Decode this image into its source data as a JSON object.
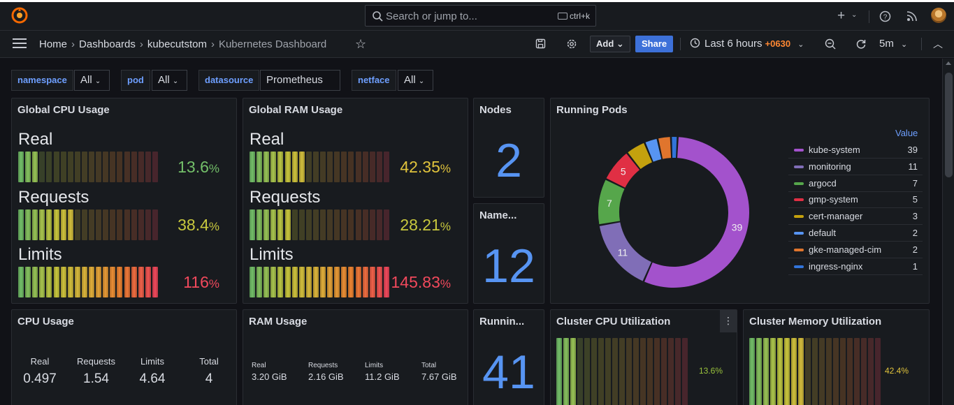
{
  "search": {
    "placeholder": "Search or jump to...",
    "shortcut": "ctrl+k"
  },
  "breadcrumb": [
    "Home",
    "Dashboards",
    "kubecutstom",
    "Kubernetes Dashboard"
  ],
  "toolbar": {
    "add_label": "Add",
    "share_label": "Share",
    "time_range": "Last 6 hours",
    "timezone": "+0630",
    "refresh_interval": "5m"
  },
  "variables": [
    {
      "label": "namespace",
      "value": "All"
    },
    {
      "label": "pod",
      "value": "All"
    },
    {
      "label": "datasource",
      "value": "Prometheus"
    },
    {
      "label": "netface",
      "value": "All"
    }
  ],
  "panels": {
    "global_cpu": {
      "title": "Global CPU Usage",
      "rows": [
        {
          "label": "Real",
          "value": "13.6",
          "unit": "%",
          "fraction": 0.136,
          "color": "#73bf69"
        },
        {
          "label": "Requests",
          "value": "38.4",
          "unit": "%",
          "fraction": 0.384,
          "color": "#c8c83e"
        },
        {
          "label": "Limits",
          "value": "116",
          "unit": "%",
          "fraction": 1.0,
          "color": "#f2495c"
        }
      ]
    },
    "global_ram": {
      "title": "Global RAM Usage",
      "rows": [
        {
          "label": "Real",
          "value": "42.35",
          "unit": "%",
          "fraction": 0.4235,
          "color": "#e0c33c"
        },
        {
          "label": "Requests",
          "value": "28.21",
          "unit": "%",
          "fraction": 0.2821,
          "color": "#c8c83e"
        },
        {
          "label": "Limits",
          "value": "145.83",
          "unit": "%",
          "fraction": 1.0,
          "color": "#f2495c"
        }
      ]
    },
    "nodes": {
      "title": "Nodes",
      "value": "2"
    },
    "namespaces": {
      "title": "Name...",
      "value": "12"
    },
    "running_pods_count": {
      "title": "Runnin...",
      "value": "41"
    },
    "running_pods": {
      "title": "Running Pods",
      "legend_header": "Value",
      "items": [
        {
          "name": "kube-system",
          "value": 39,
          "color": "#a352cc"
        },
        {
          "name": "monitoring",
          "value": 11,
          "color": "#806eb7"
        },
        {
          "name": "argocd",
          "value": 7,
          "color": "#56a64b"
        },
        {
          "name": "gmp-system",
          "value": 5,
          "color": "#e02f44"
        },
        {
          "name": "cert-manager",
          "value": 3,
          "color": "#c4a10e"
        },
        {
          "name": "default",
          "value": 2,
          "color": "#5794f2"
        },
        {
          "name": "gke-managed-cim",
          "value": 2,
          "color": "#e0752d"
        },
        {
          "name": "ingress-nginx",
          "value": 1,
          "color": "#3274d9"
        }
      ],
      "slice_labels": [
        "39",
        "11",
        "7",
        "5"
      ]
    },
    "cpu_usage": {
      "title": "CPU Usage",
      "stats": [
        {
          "label": "Real",
          "value": "0.497"
        },
        {
          "label": "Requests",
          "value": "1.54"
        },
        {
          "label": "Limits",
          "value": "4.64"
        },
        {
          "label": "Total",
          "value": "4"
        }
      ]
    },
    "ram_usage": {
      "title": "RAM Usage",
      "stats": [
        {
          "label": "Real",
          "value": "3.20 GiB"
        },
        {
          "label": "Requests",
          "value": "2.16 GiB"
        },
        {
          "label": "Limits",
          "value": "11.2 GiB"
        },
        {
          "label": "Total",
          "value": "7.67 GiB"
        }
      ]
    },
    "cluster_cpu": {
      "title": "Cluster CPU Utilization",
      "value": "13.6%",
      "fraction": 0.136,
      "color": "#73bf69"
    },
    "cluster_mem": {
      "title": "Cluster Memory Utilization",
      "value": "42.4%",
      "fraction": 0.424,
      "color": "#e0c33c"
    }
  },
  "icons": {
    "logo": "grafana-logo-icon",
    "search": "search-icon",
    "keyboard": "keyboard-icon",
    "new": "plus-icon",
    "help": "help-icon",
    "news": "rss-icon",
    "menu": "hamburger-icon",
    "star": "star-icon",
    "save": "save-icon",
    "settings": "gear-icon",
    "clock": "clock-icon",
    "zoom_out": "zoom-out-icon",
    "refresh": "refresh-icon",
    "collapse": "chevron-up-icon",
    "panel_menu": "kebab-menu-icon"
  }
}
